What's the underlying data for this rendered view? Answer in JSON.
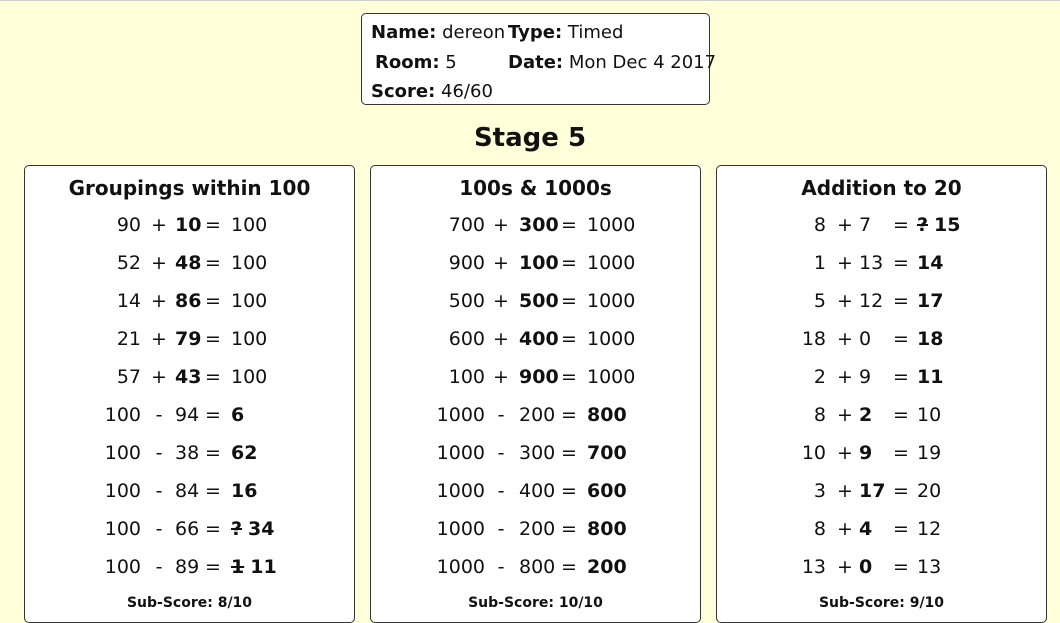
{
  "header": {
    "name_label": "Name:",
    "name": "dereon",
    "type_label": "Type:",
    "type": "Timed",
    "room_label": "Room:",
    "room": "5",
    "date_label": "Date:",
    "date": "Mon Dec 4 2017",
    "score_label": "Score:",
    "score": "46/60"
  },
  "stage_title": "Stage 5",
  "panels": [
    {
      "title": "Groupings within 100",
      "sub_score": "Sub-Score: 8/10",
      "rows": [
        {
          "a": "90",
          "op": "+",
          "b": "10",
          "eq": "=",
          "r": "100",
          "blank": "b"
        },
        {
          "a": "52",
          "op": "+",
          "b": "48",
          "eq": "=",
          "r": "100",
          "blank": "b"
        },
        {
          "a": "14",
          "op": "+",
          "b": "86",
          "eq": "=",
          "r": "100",
          "blank": "b"
        },
        {
          "a": "21",
          "op": "+",
          "b": "79",
          "eq": "=",
          "r": "100",
          "blank": "b"
        },
        {
          "a": "57",
          "op": "+",
          "b": "43",
          "eq": "=",
          "r": "100",
          "blank": "b"
        },
        {
          "a": "100",
          "op": "-",
          "b": "94",
          "eq": "=",
          "r": "6",
          "blank": "r"
        },
        {
          "a": "100",
          "op": "-",
          "b": "38",
          "eq": "=",
          "r": "62",
          "blank": "r"
        },
        {
          "a": "100",
          "op": "-",
          "b": "84",
          "eq": "=",
          "r": "16",
          "blank": "r"
        },
        {
          "a": "100",
          "op": "-",
          "b": "66",
          "eq": "=",
          "r": "34",
          "blank": "r",
          "wrong": "?"
        },
        {
          "a": "100",
          "op": "-",
          "b": "89",
          "eq": "=",
          "r": "11",
          "blank": "r",
          "wrong": "1"
        }
      ]
    },
    {
      "title": "100s & 1000s",
      "sub_score": "Sub-Score: 10/10",
      "rows": [
        {
          "a": "700",
          "op": "+",
          "b": "300",
          "eq": "=",
          "r": "1000",
          "blank": "b"
        },
        {
          "a": "900",
          "op": "+",
          "b": "100",
          "eq": "=",
          "r": "1000",
          "blank": "b"
        },
        {
          "a": "500",
          "op": "+",
          "b": "500",
          "eq": "=",
          "r": "1000",
          "blank": "b"
        },
        {
          "a": "600",
          "op": "+",
          "b": "400",
          "eq": "=",
          "r": "1000",
          "blank": "b"
        },
        {
          "a": "100",
          "op": "+",
          "b": "900",
          "eq": "=",
          "r": "1000",
          "blank": "b"
        },
        {
          "a": "1000",
          "op": "-",
          "b": "200",
          "eq": "=",
          "r": "800",
          "blank": "r"
        },
        {
          "a": "1000",
          "op": "-",
          "b": "300",
          "eq": "=",
          "r": "700",
          "blank": "r"
        },
        {
          "a": "1000",
          "op": "-",
          "b": "400",
          "eq": "=",
          "r": "600",
          "blank": "r"
        },
        {
          "a": "1000",
          "op": "-",
          "b": "200",
          "eq": "=",
          "r": "800",
          "blank": "r"
        },
        {
          "a": "1000",
          "op": "-",
          "b": "800",
          "eq": "=",
          "r": "200",
          "blank": "r"
        }
      ]
    },
    {
      "title": "Addition to 20",
      "sub_score": "Sub-Score: 9/10",
      "rows": [
        {
          "a": "8",
          "op": "+",
          "b": "7",
          "eq": "=",
          "r": "15",
          "blank": "r",
          "wrong": "?"
        },
        {
          "a": "1",
          "op": "+",
          "b": "13",
          "eq": "=",
          "r": "14",
          "blank": "r"
        },
        {
          "a": "5",
          "op": "+",
          "b": "12",
          "eq": "=",
          "r": "17",
          "blank": "r"
        },
        {
          "a": "18",
          "op": "+",
          "b": "0",
          "eq": "=",
          "r": "18",
          "blank": "r"
        },
        {
          "a": "2",
          "op": "+",
          "b": "9",
          "eq": "=",
          "r": "11",
          "blank": "r"
        },
        {
          "a": "8",
          "op": "+",
          "b": "2",
          "eq": "=",
          "r": "10",
          "blank": "b"
        },
        {
          "a": "10",
          "op": "+",
          "b": "9",
          "eq": "=",
          "r": "19",
          "blank": "b"
        },
        {
          "a": "3",
          "op": "+",
          "b": "17",
          "eq": "=",
          "r": "20",
          "blank": "b"
        },
        {
          "a": "8",
          "op": "+",
          "b": "4",
          "eq": "=",
          "r": "12",
          "blank": "b"
        },
        {
          "a": "13",
          "op": "+",
          "b": "0",
          "eq": "=",
          "r": "13",
          "blank": "b"
        }
      ]
    }
  ]
}
